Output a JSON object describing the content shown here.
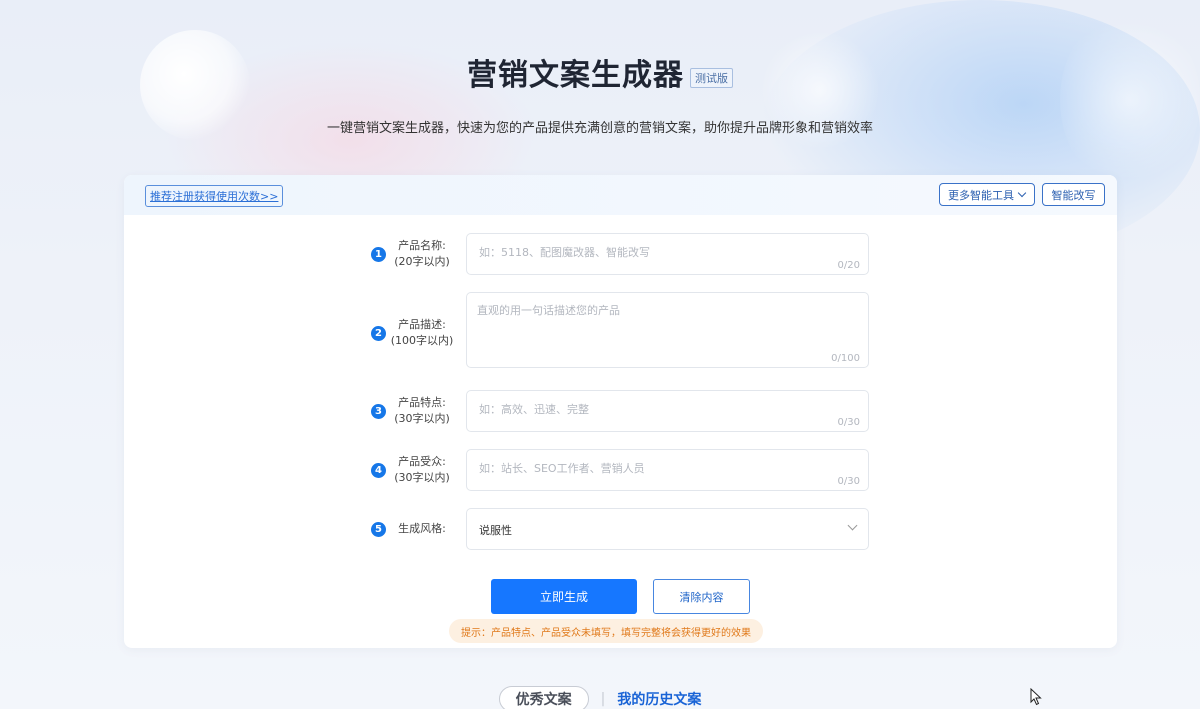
{
  "header": {
    "title": "营销文案生成器",
    "beta_badge": "测试版",
    "subtitle": "一键营销文案生成器，快速为您的产品提供充满创意的营销文案，助你提升品牌形象和营销效率"
  },
  "toolbar": {
    "promo_link": "推荐注册获得使用次数>>",
    "more_tools_label": "更多智能工具",
    "smart_rewrite_label": "智能改写"
  },
  "form": {
    "fields": [
      {
        "step": "1",
        "label": "产品名称:",
        "limit": "(20字以内)",
        "placeholder": "如：5118、配图魔改器、智能改写",
        "counter": "0/20"
      },
      {
        "step": "2",
        "label": "产品描述:",
        "limit": "(100字以内)",
        "placeholder": "直观的用一句话描述您的产品",
        "counter": "0/100"
      },
      {
        "step": "3",
        "label": "产品特点:",
        "limit": "(30字以内)",
        "placeholder": "如：高效、迅速、完整",
        "counter": "0/30"
      },
      {
        "step": "4",
        "label": "产品受众:",
        "limit": "(30字以内)",
        "placeholder": "如：站长、SEO工作者、营销人员",
        "counter": "0/30"
      }
    ],
    "style": {
      "step": "5",
      "label": "生成风格:",
      "value": "说服性"
    },
    "generate_label": "立即生成",
    "clear_label": "清除内容",
    "hint": "提示：产品特点、产品受众未填写，填写完整将会获得更好的效果"
  },
  "bottom_tabs": {
    "excellent": "优秀文案",
    "separator": "|",
    "history": "我的历史文案"
  },
  "colors": {
    "accent": "#1677ff",
    "hint_text": "#e0791a",
    "hint_bg": "#fdf0e1"
  }
}
